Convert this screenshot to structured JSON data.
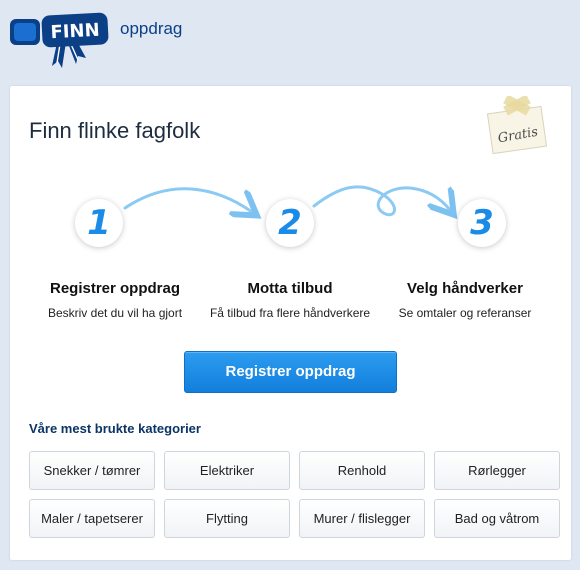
{
  "header": {
    "logo_text": "FINN",
    "site_name": "oppdrag"
  },
  "main": {
    "headline": "Finn flinke fagfolk",
    "badge": "Gratis",
    "steps": [
      {
        "number": "1",
        "title": "Registrer oppdrag",
        "description": "Beskriv det du vil ha gjort"
      },
      {
        "number": "2",
        "title": "Motta tilbud",
        "description": "Få tilbud fra flere håndverkere"
      },
      {
        "number": "3",
        "title": "Velg håndverker",
        "description": "Se omtaler og referanser"
      }
    ],
    "cta_label": "Registrer oppdrag"
  },
  "categories": {
    "heading": "Våre mest brukte kategorier",
    "items": [
      "Snekker / tømrer",
      "Elektriker",
      "Renhold",
      "Rørlegger",
      "Maler / tapetserer",
      "Flytting",
      "Murer / flislegger",
      "Bad og våtrom"
    ]
  },
  "colors": {
    "accent": "#1a8be6",
    "brand": "#0b3f86",
    "page_bg": "#dfe7f3"
  }
}
